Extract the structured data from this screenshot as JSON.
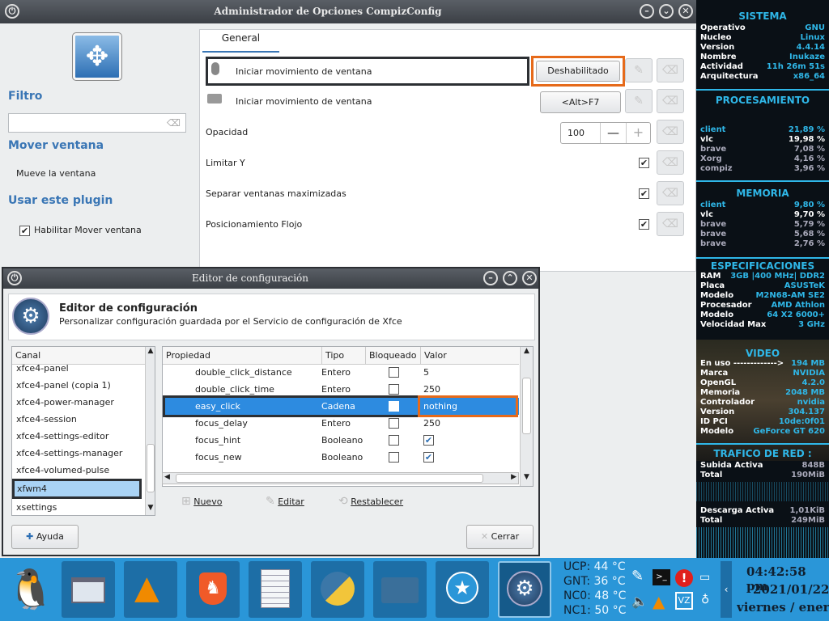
{
  "compiz": {
    "title": "Administrador de Opciones CompizConfig",
    "filtro": "Filtro",
    "mover_ventana": "Mover ventana",
    "mueve_la_ventana": "Mueve la ventana",
    "usar_plugin": "Usar este plugin",
    "habilitar": "Habilitar Mover ventana",
    "tab": "General",
    "rows": [
      {
        "label": "Iniciar movimiento de ventana",
        "value": "Deshabilitado"
      },
      {
        "label": "Iniciar movimiento de ventana",
        "value": "<Alt>F7"
      },
      {
        "label": "Opacidad",
        "value": "100"
      },
      {
        "label": "Limitar Y"
      },
      {
        "label": "Separar ventanas maximizadas"
      },
      {
        "label": "Posicionamiento Flojo"
      }
    ]
  },
  "editor": {
    "title": "Editor de configuración",
    "heading": "Editor de configuración",
    "subtitle": "Personalizar configuración guardada por el Servicio de configuración de Xfce",
    "canal_header": "Canal",
    "channels": [
      "xfce4-panel",
      "xfce4-panel (copia 1)",
      "xfce4-power-manager",
      "xfce4-session",
      "xfce4-settings-editor",
      "xfce4-settings-manager",
      "xfce4-volumed-pulse",
      "xfwm4",
      "xsettings"
    ],
    "cols": {
      "prop": "Propiedad",
      "tipo": "Tipo",
      "bloq": "Bloqueado",
      "valor": "Valor"
    },
    "props": [
      {
        "name": "double_click_distance",
        "type": "Entero",
        "value": "5"
      },
      {
        "name": "double_click_time",
        "type": "Entero",
        "value": "250"
      },
      {
        "name": "easy_click",
        "type": "Cadena",
        "value": "nothing"
      },
      {
        "name": "focus_delay",
        "type": "Entero",
        "value": "250"
      },
      {
        "name": "focus_hint",
        "type": "Booleano",
        "value": ""
      },
      {
        "name": "focus_new",
        "type": "Booleano",
        "value": ""
      }
    ],
    "nuevo": "Nuevo",
    "editar": "Editar",
    "restablecer": "Restablecer",
    "ayuda": "Ayuda",
    "cerrar": "Cerrar"
  },
  "conky": {
    "sistema": "SISTEMA",
    "sys": [
      [
        "Operativo",
        "GNU"
      ],
      [
        "Nucleo",
        "Linux"
      ],
      [
        "Version",
        "4.4.14"
      ],
      [
        "Nombre",
        "Inukaze"
      ],
      [
        "Actividad",
        "11h 26m 51s"
      ],
      [
        "Arquitectura",
        "x86_64"
      ]
    ],
    "procesamiento": "PROCESAMIENTO",
    "cpu": [
      [
        "client",
        "21,89 %"
      ],
      [
        "vlc",
        "19,98 %"
      ],
      [
        "brave",
        "7,08 %"
      ],
      [
        "Xorg",
        "4,16 %"
      ],
      [
        "compiz",
        "3,96 %"
      ]
    ],
    "memoria": "MEMORIA",
    "mem": [
      [
        "client",
        "9,80 %"
      ],
      [
        "vlc",
        "9,70 %"
      ],
      [
        "brave",
        "5,79 %"
      ],
      [
        "brave",
        "5,68 %"
      ],
      [
        "brave",
        "2,76 %"
      ]
    ],
    "especificaciones": "ESPECIFICACIONES",
    "spec": [
      [
        "RAM",
        "3GB |400 MHz| DDR2"
      ],
      [
        "Placa",
        "ASUSTeK"
      ],
      [
        "Modelo",
        "M2N68-AM SE2"
      ],
      [
        "Procesador",
        "AMD Athlon"
      ],
      [
        "Modelo",
        "64 X2 6000+"
      ],
      [
        "Velocidad Max",
        "3 GHz"
      ]
    ],
    "video": "VIDEO",
    "vid": [
      [
        "En uso ------------->",
        "194 MB"
      ],
      [
        "Marca",
        "NVIDIA"
      ],
      [
        "OpenGL",
        "4.2.0"
      ],
      [
        "Memoria",
        "2048 MB"
      ],
      [
        "Controlador",
        "nvidia"
      ],
      [
        "Version",
        "304.137"
      ],
      [
        "ID PCI",
        "10de:0f01"
      ],
      [
        "Modelo",
        "GeForce GT 620"
      ]
    ],
    "red": "TRAFICO DE RED :",
    "up": [
      [
        "Subida Activa",
        "848B"
      ],
      [
        "Total",
        "190MiB"
      ]
    ],
    "down": [
      [
        "Descarga Activa",
        "1,01KiB"
      ],
      [
        "Total",
        "249MiB"
      ]
    ]
  },
  "panel": {
    "temps": [
      [
        "UCP:",
        "44 °C"
      ],
      [
        "GNT:",
        "36 °C"
      ],
      [
        "NC0:",
        "48 °C"
      ],
      [
        "NC1:",
        "50 °C"
      ]
    ],
    "time": "04:42:58 pm",
    "date": "2021/01/22",
    "day": "viernes / enero"
  }
}
